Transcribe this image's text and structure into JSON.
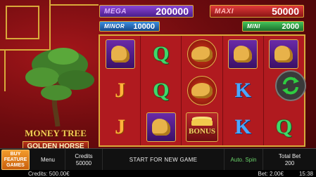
{
  "jackpots": {
    "mega": {
      "label": "MEGA",
      "value": "200000"
    },
    "maxi": {
      "label": "MAXI",
      "value": "50000"
    },
    "minor": {
      "label": "MINOR",
      "value": "10000"
    },
    "mini": {
      "label": "MINI",
      "value": "2000"
    }
  },
  "reels": [
    [
      "horse",
      "J",
      "J"
    ],
    [
      "Q",
      "Q",
      "horse"
    ],
    [
      "toad",
      "toad",
      "bonus"
    ],
    [
      "horse",
      "K",
      "K"
    ],
    [
      "horse",
      "Q",
      "Q"
    ]
  ],
  "logo": {
    "line1": "MONEY TREE",
    "line2": "GOLDEN HORSE"
  },
  "bonus_text": "BONUS",
  "bottom_bar": {
    "buy_feature": "BUY FEATURE GAMES",
    "menu": "Menu",
    "credits_label": "Credits",
    "credits_value": "50000",
    "start": "START FOR NEW GAME",
    "auto_spin": "Auto. Spin",
    "total_bet_label": "Total Bet",
    "total_bet_value": "200"
  },
  "status_bar": {
    "credits": "Credits: 500.00€",
    "bet": "Bet: 2.00€",
    "time": "15:38"
  },
  "colors": {
    "mega": "#8a45d6",
    "maxi": "#e23a3a",
    "minor": "#3b8ee0",
    "mini": "#42c45a",
    "reel_bg": "#b01a1f",
    "gold": "#d8a93a"
  },
  "icons": {
    "refresh": "refresh-arrows-icon"
  }
}
